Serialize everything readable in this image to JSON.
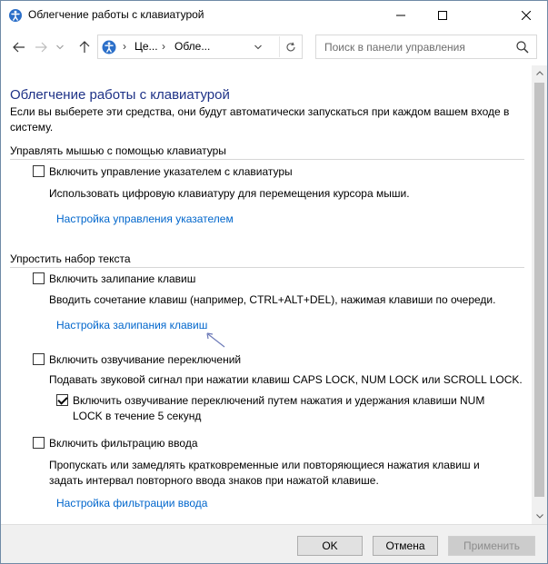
{
  "window": {
    "title": "Облегчение работы с клавиатурой"
  },
  "address_bar": {
    "crumbs": [
      "Це...",
      "Обле..."
    ],
    "search_placeholder": "Поиск в панели управления"
  },
  "page": {
    "title": "Облегчение работы с клавиатурой",
    "intro": "Если вы выберете эти средства, они будут автоматически запускаться при каждом вашем входе в систему."
  },
  "sections": {
    "mouse_keys": {
      "heading": "Управлять мышью с помощью клавиатуры",
      "checkbox_label": "Включить управление указателем с клавиатуры",
      "checked": false,
      "description": "Использовать цифровую клавиатуру для перемещения курсора мыши.",
      "link": "Настройка управления указателем"
    },
    "typing": {
      "heading": "Упростить набор текста",
      "sticky": {
        "checkbox_label": "Включить залипание клавиш",
        "checked": false,
        "description": "Вводить сочетание клавиш (например, CTRL+ALT+DEL), нажимая клавиши по очереди.",
        "link": "Настройка залипания клавиш"
      },
      "toggle": {
        "checkbox_label": "Включить озвучивание переключений",
        "checked": false,
        "description": "Подавать звуковой сигнал при нажатии клавиш CAPS LOCK, NUM LOCK или SCROLL LOCK.",
        "sub_checkbox_label": "Включить озвучивание переключений путем нажатия и удержания клавиши NUM LOCK в течение 5 секунд",
        "sub_checked": true
      },
      "filter": {
        "checkbox_label": "Включить фильтрацию ввода",
        "checked": false,
        "description": "Пропускать или замедлять кратковременные или повторяющиеся нажатия клавиш и задать интервал повторного ввода знаков при нажатой клавише.",
        "link": "Настройка фильтрации ввода"
      }
    }
  },
  "footer": {
    "ok_label": "OK",
    "cancel_label": "Отмена",
    "apply_label": "Применить"
  },
  "colors": {
    "title_blue": "#1e3287",
    "link_blue": "#0066cc"
  }
}
